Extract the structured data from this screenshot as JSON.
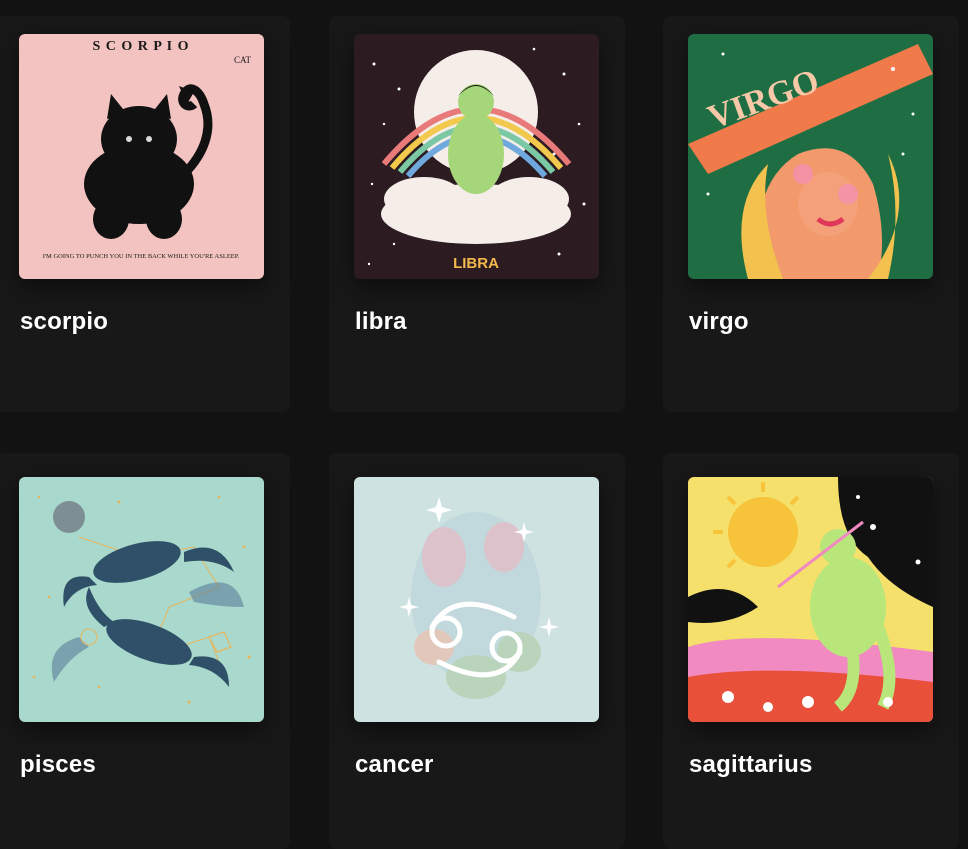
{
  "cards": [
    {
      "title": "scorpio",
      "art": {
        "heading": "S C O R P I O",
        "subheading": "CAT",
        "caption": "I'M GOING TO PUNCH YOU IN THE BACK WHILE YOU'RE ASLEEP.",
        "bg": "#f2c3c0"
      }
    },
    {
      "title": "libra",
      "art": {
        "text": "LIBRA",
        "bg": "#2c1c22"
      }
    },
    {
      "title": "virgo",
      "art": {
        "text": "VIRGO",
        "bg": "#1f6e43"
      }
    },
    {
      "title": "pisces",
      "art": {
        "bg": "#a9d9cc"
      }
    },
    {
      "title": "cancer",
      "art": {
        "bg": "#cfe2e2"
      }
    },
    {
      "title": "sagittarius",
      "art": {
        "bg": "#f4e06a"
      }
    }
  ]
}
